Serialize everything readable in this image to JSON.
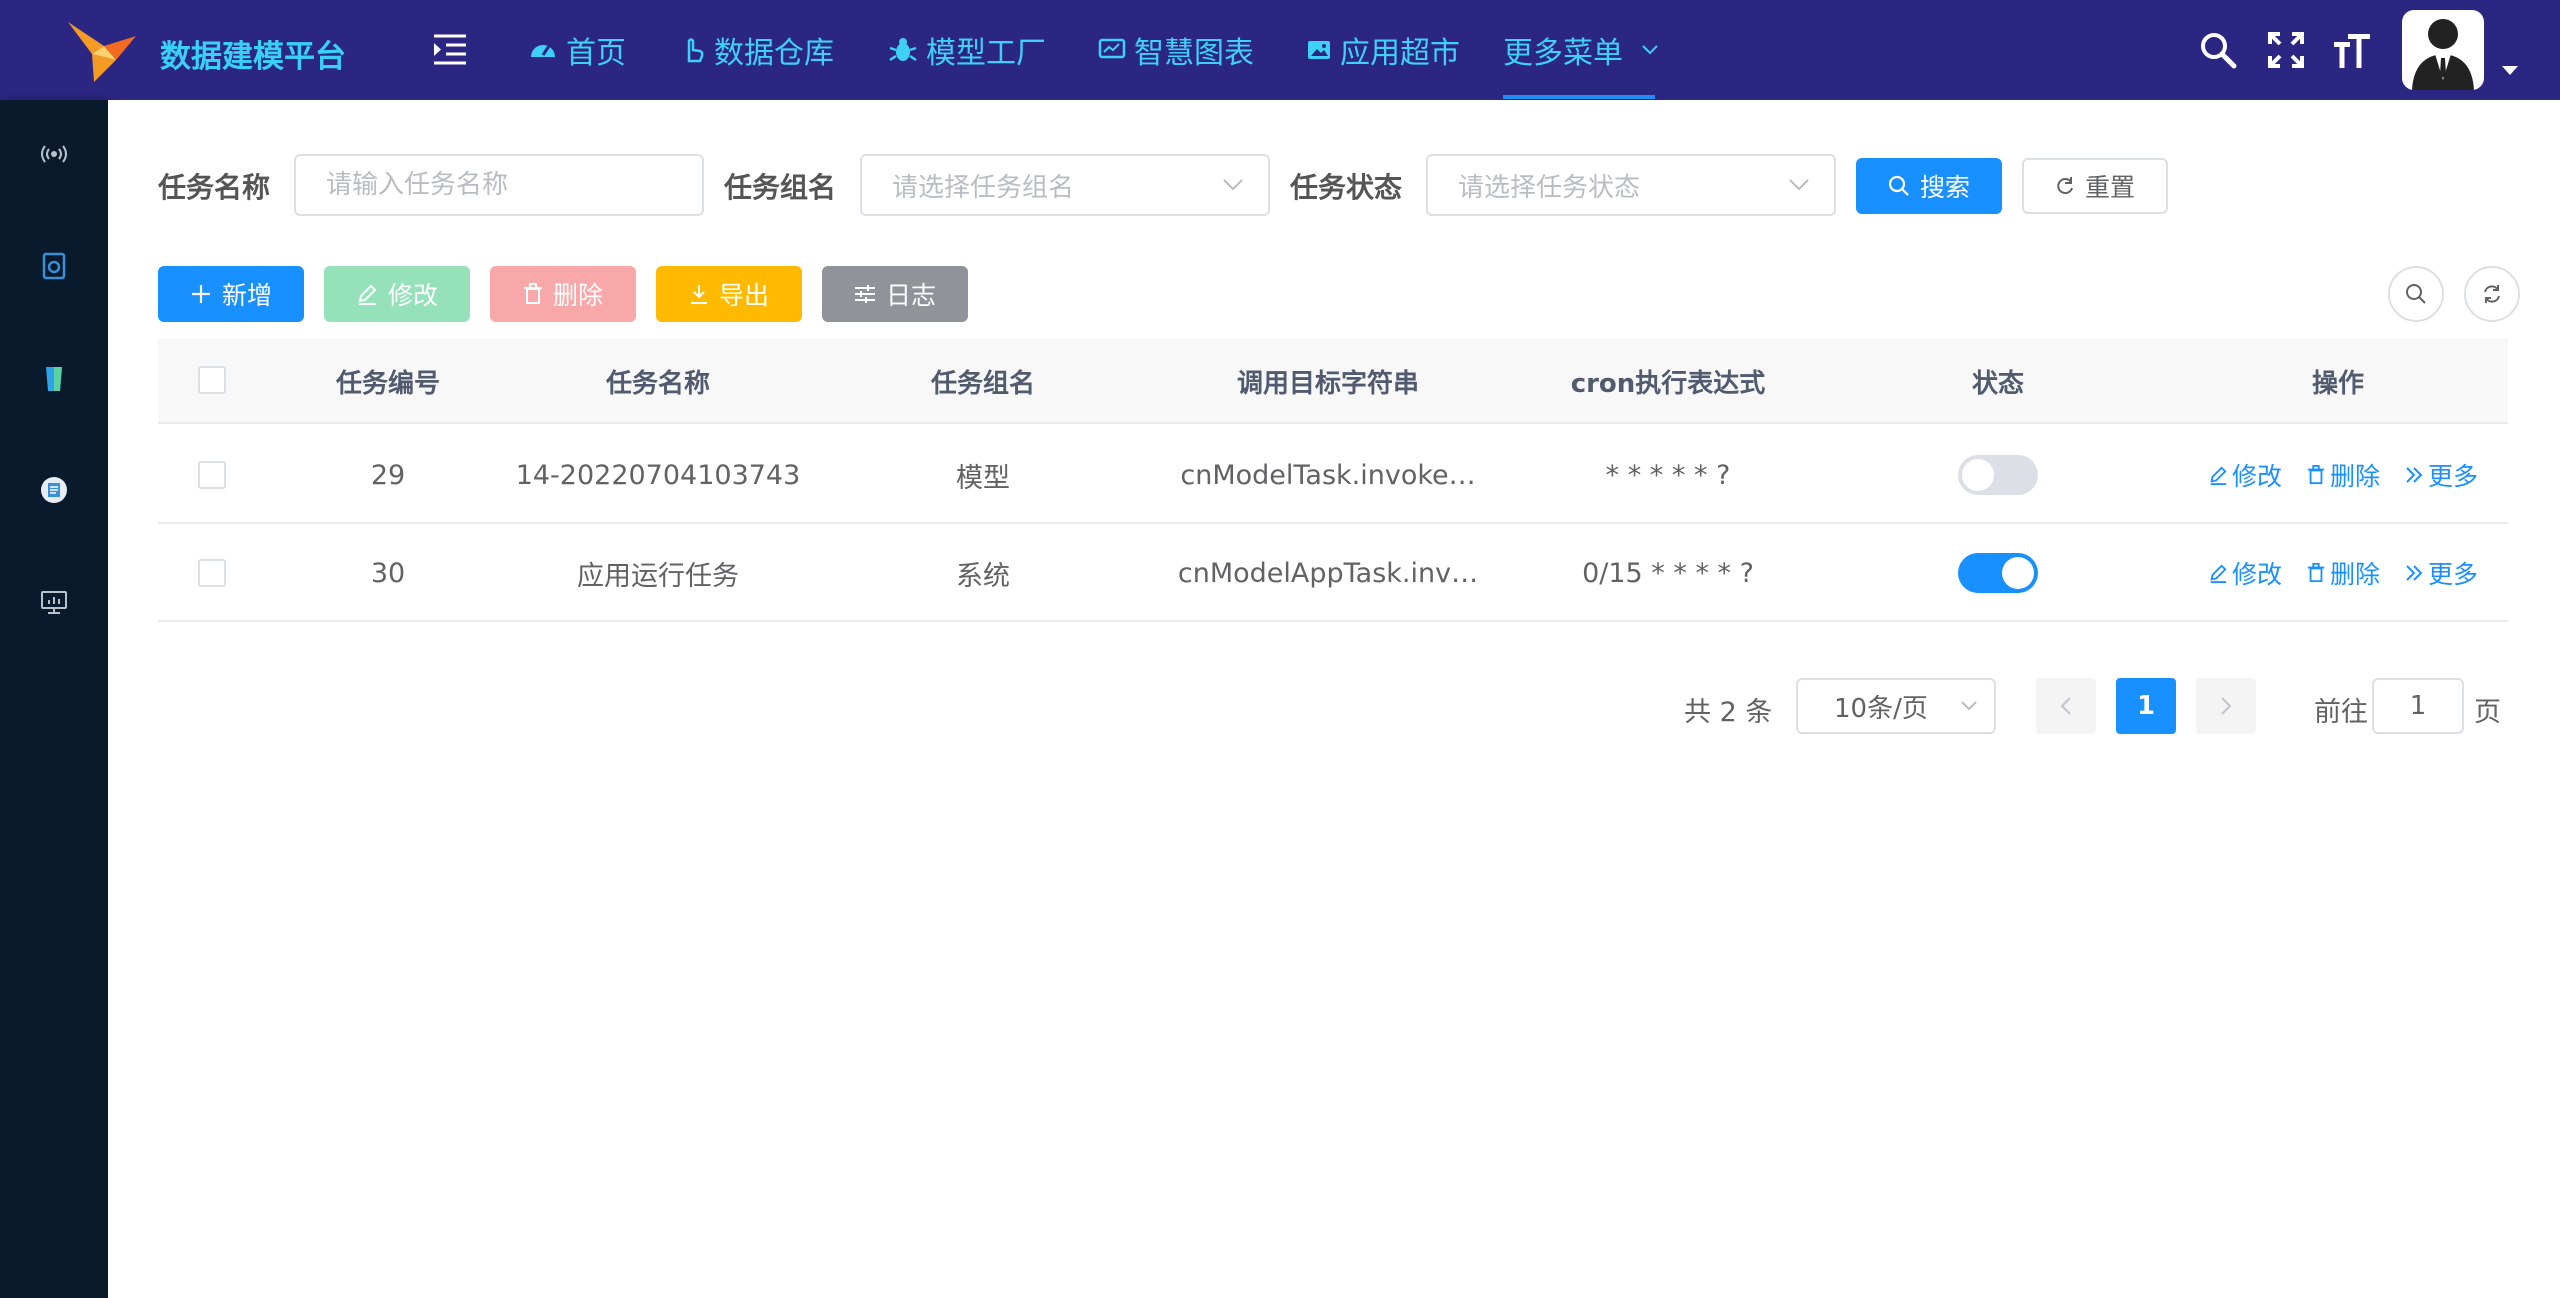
{
  "header": {
    "brand": "数据建模平台",
    "nav": [
      {
        "label": "首页",
        "icon": "dashboard-icon"
      },
      {
        "label": "数据仓库",
        "icon": "pointer-icon"
      },
      {
        "label": "模型工厂",
        "icon": "bug-icon"
      },
      {
        "label": "智慧图表",
        "icon": "monitor-icon"
      },
      {
        "label": "应用超市",
        "icon": "picture-icon"
      },
      {
        "label": "更多菜单",
        "icon": "chevron-down-icon"
      }
    ],
    "active_nav": "更多菜单",
    "accent": "#3fd0f6",
    "bg": "#2c2683"
  },
  "sidebar": {
    "items": [
      "broadcast-icon",
      "camera-icon",
      "cup-icon",
      "document-icon",
      "monitor-icon"
    ]
  },
  "search": {
    "task_name_label": "任务名称",
    "task_name_placeholder": "请输入任务名称",
    "task_group_label": "任务组名",
    "task_group_placeholder": "请选择任务组名",
    "task_status_label": "任务状态",
    "task_status_placeholder": "请选择任务状态",
    "search_btn": "搜索",
    "reset_btn": "重置"
  },
  "toolbar": {
    "add": "新增",
    "edit": "修改",
    "delete": "删除",
    "export": "导出",
    "log": "日志"
  },
  "table": {
    "columns": [
      "任务编号",
      "任务名称",
      "任务组名",
      "调用目标字符串",
      "cron执行表达式",
      "状态",
      "操作"
    ],
    "rows": [
      {
        "id": "29",
        "name": "14-20220704103743",
        "group": "模型",
        "target": "cnModelTask.invoke…",
        "cron": "* * * * * ?",
        "status_on": false
      },
      {
        "id": "30",
        "name": "应用运行任务",
        "group": "系统",
        "target": "cnModelAppTask.inv…",
        "cron": "0/15 * * * * ?",
        "status_on": true
      }
    ],
    "ops": {
      "edit": "修改",
      "delete": "删除",
      "more": "更多"
    }
  },
  "pagination": {
    "total": "共 2 条",
    "page_size": "10条/页",
    "current": "1",
    "goto_prefix": "前往",
    "goto_value": "1",
    "goto_suffix": "页"
  }
}
